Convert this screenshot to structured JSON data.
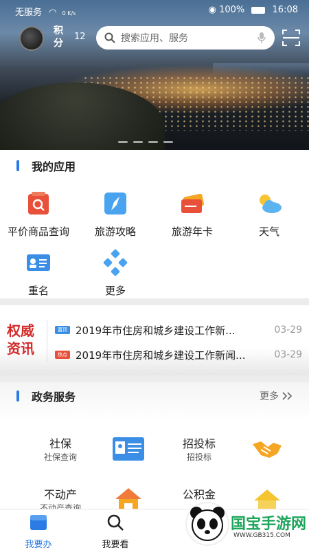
{
  "status_bar": {
    "carrier": "无服务",
    "net_speed": "0 K/s",
    "battery": "100%",
    "time": "16:08"
  },
  "header": {
    "points_label": "积分",
    "points_value": "12",
    "search_placeholder": "搜索应用、服务"
  },
  "my_apps": {
    "title": "我的应用",
    "items": [
      {
        "label": "平价商品查询",
        "icon": "price-search-icon"
      },
      {
        "label": "旅游攻略",
        "icon": "compass-icon"
      },
      {
        "label": "旅游年卡",
        "icon": "ticket-card-icon"
      },
      {
        "label": "天气",
        "icon": "weather-icon"
      },
      {
        "label": "重名",
        "icon": "id-card-icon"
      },
      {
        "label": "更多",
        "icon": "more-diamonds-icon"
      }
    ]
  },
  "news": {
    "brand": "权威资讯",
    "items": [
      {
        "tag": "置顶",
        "title": "2019年市住房和城乡建设工作新...",
        "date": "03-29"
      },
      {
        "tag": "热点",
        "title": "2019年市住房和城乡建设工作新闻...",
        "date": "03-29"
      }
    ]
  },
  "gov_services": {
    "title": "政务服务",
    "more": "更多",
    "items": [
      {
        "name": "社保",
        "sub": "社保查询",
        "icon": "social-security-card-icon"
      },
      {
        "name": "招投标",
        "sub": "招投标",
        "icon": "handshake-icon"
      },
      {
        "name": "不动产",
        "sub": "不动产查询",
        "icon": "house-icon"
      },
      {
        "name": "公积金",
        "sub": "",
        "icon": "housing-fund-icon"
      }
    ]
  },
  "bottom_nav": {
    "items": [
      {
        "label": "我要办",
        "active": true
      },
      {
        "label": "我要看",
        "active": false
      }
    ]
  },
  "watermark": {
    "text": "国宝手游网",
    "url": "WWW.GB315.COM"
  },
  "colors": {
    "accent": "#2a7be4",
    "news_brand": "#d42a2a",
    "watermark_green": "#1da55a"
  }
}
